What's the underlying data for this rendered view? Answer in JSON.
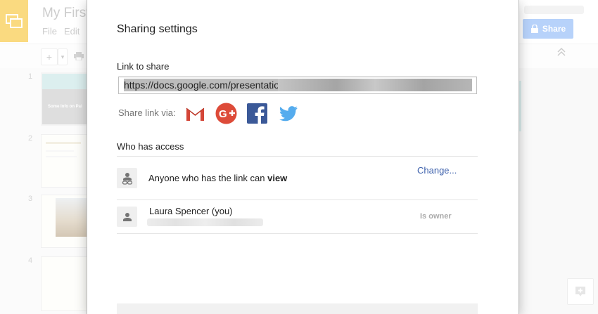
{
  "app": {
    "doc_title": "My First",
    "menu": [
      "File",
      "Edit"
    ],
    "share_button": "Share",
    "slide_numbers": [
      "1",
      "2",
      "3",
      "4"
    ],
    "slide1_title": "Some Info on Pai"
  },
  "dialog": {
    "title": "Sharing settings",
    "link_label": "Link to share",
    "link_url": "https://docs.google.com/presentation/",
    "share_via_label": "Share link via:",
    "social": [
      "gmail-icon",
      "google-plus-icon",
      "facebook-icon",
      "twitter-icon"
    ],
    "who_has_access_label": "Who has access",
    "link_access": {
      "text_prefix": "Anyone who has the link can ",
      "permission": "view",
      "change_label": "Change..."
    },
    "owner": {
      "name": "Laura Spencer (you)",
      "role": "Is owner"
    }
  },
  "colors": {
    "brand_yellow": "#f4b400",
    "share_blue": "#6fa5f5",
    "link_blue": "#3b5fab",
    "gmail_red": "#d44638",
    "gplus_red": "#dd4b39",
    "facebook_blue": "#3b5998",
    "twitter_blue": "#55acee"
  }
}
